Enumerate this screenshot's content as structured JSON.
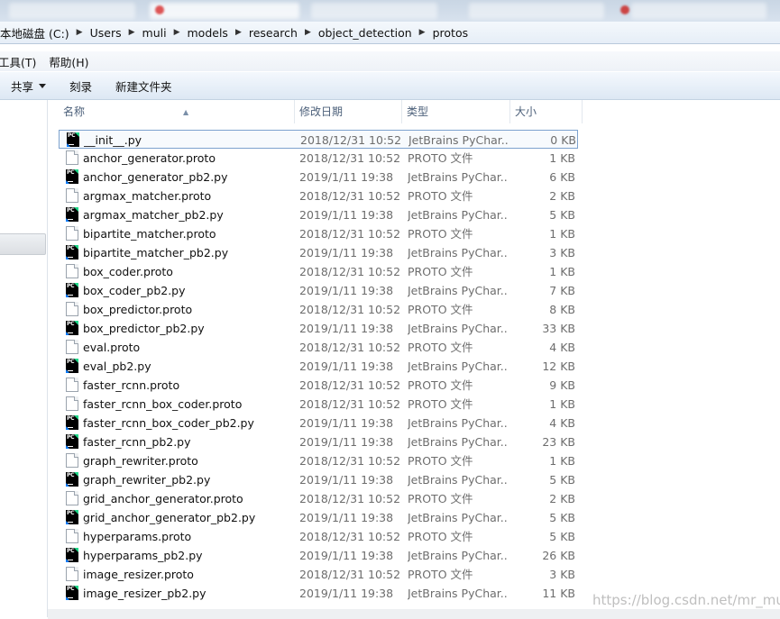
{
  "address": {
    "crumbs": [
      "本地磁盘 (C:)",
      "Users",
      "muli",
      "models",
      "research",
      "object_detection",
      "protos"
    ]
  },
  "menu": [
    "工具(T)",
    "帮助(H)"
  ],
  "toolbar": {
    "share": "共享",
    "burn": "刻录",
    "new_folder": "新建文件夹"
  },
  "columns": {
    "name": "名称",
    "date": "修改日期",
    "type": "类型",
    "size": "大小"
  },
  "files": [
    {
      "name": "__init__.py",
      "date": "2018/12/31 10:52",
      "type": "JetBrains PyChar...",
      "size": "0 KB",
      "kind": "py"
    },
    {
      "name": "anchor_generator.proto",
      "date": "2018/12/31 10:52",
      "type": "PROTO 文件",
      "size": "1 KB",
      "kind": "proto"
    },
    {
      "name": "anchor_generator_pb2.py",
      "date": "2019/1/11 19:38",
      "type": "JetBrains PyChar...",
      "size": "6 KB",
      "kind": "py"
    },
    {
      "name": "argmax_matcher.proto",
      "date": "2018/12/31 10:52",
      "type": "PROTO 文件",
      "size": "2 KB",
      "kind": "proto"
    },
    {
      "name": "argmax_matcher_pb2.py",
      "date": "2019/1/11 19:38",
      "type": "JetBrains PyChar...",
      "size": "5 KB",
      "kind": "py"
    },
    {
      "name": "bipartite_matcher.proto",
      "date": "2018/12/31 10:52",
      "type": "PROTO 文件",
      "size": "1 KB",
      "kind": "proto"
    },
    {
      "name": "bipartite_matcher_pb2.py",
      "date": "2019/1/11 19:38",
      "type": "JetBrains PyChar...",
      "size": "3 KB",
      "kind": "py"
    },
    {
      "name": "box_coder.proto",
      "date": "2018/12/31 10:52",
      "type": "PROTO 文件",
      "size": "1 KB",
      "kind": "proto"
    },
    {
      "name": "box_coder_pb2.py",
      "date": "2019/1/11 19:38",
      "type": "JetBrains PyChar...",
      "size": "7 KB",
      "kind": "py"
    },
    {
      "name": "box_predictor.proto",
      "date": "2018/12/31 10:52",
      "type": "PROTO 文件",
      "size": "8 KB",
      "kind": "proto"
    },
    {
      "name": "box_predictor_pb2.py",
      "date": "2019/1/11 19:38",
      "type": "JetBrains PyChar...",
      "size": "33 KB",
      "kind": "py"
    },
    {
      "name": "eval.proto",
      "date": "2018/12/31 10:52",
      "type": "PROTO 文件",
      "size": "4 KB",
      "kind": "proto"
    },
    {
      "name": "eval_pb2.py",
      "date": "2019/1/11 19:38",
      "type": "JetBrains PyChar...",
      "size": "12 KB",
      "kind": "py"
    },
    {
      "name": "faster_rcnn.proto",
      "date": "2018/12/31 10:52",
      "type": "PROTO 文件",
      "size": "9 KB",
      "kind": "proto"
    },
    {
      "name": "faster_rcnn_box_coder.proto",
      "date": "2018/12/31 10:52",
      "type": "PROTO 文件",
      "size": "1 KB",
      "kind": "proto"
    },
    {
      "name": "faster_rcnn_box_coder_pb2.py",
      "date": "2019/1/11 19:38",
      "type": "JetBrains PyChar...",
      "size": "4 KB",
      "kind": "py"
    },
    {
      "name": "faster_rcnn_pb2.py",
      "date": "2019/1/11 19:38",
      "type": "JetBrains PyChar...",
      "size": "23 KB",
      "kind": "py"
    },
    {
      "name": "graph_rewriter.proto",
      "date": "2018/12/31 10:52",
      "type": "PROTO 文件",
      "size": "1 KB",
      "kind": "proto"
    },
    {
      "name": "graph_rewriter_pb2.py",
      "date": "2019/1/11 19:38",
      "type": "JetBrains PyChar...",
      "size": "5 KB",
      "kind": "py"
    },
    {
      "name": "grid_anchor_generator.proto",
      "date": "2018/12/31 10:52",
      "type": "PROTO 文件",
      "size": "2 KB",
      "kind": "proto"
    },
    {
      "name": "grid_anchor_generator_pb2.py",
      "date": "2019/1/11 19:38",
      "type": "JetBrains PyChar...",
      "size": "5 KB",
      "kind": "py"
    },
    {
      "name": "hyperparams.proto",
      "date": "2018/12/31 10:52",
      "type": "PROTO 文件",
      "size": "5 KB",
      "kind": "proto"
    },
    {
      "name": "hyperparams_pb2.py",
      "date": "2019/1/11 19:38",
      "type": "JetBrains PyChar...",
      "size": "26 KB",
      "kind": "py"
    },
    {
      "name": "image_resizer.proto",
      "date": "2018/12/31 10:52",
      "type": "PROTO 文件",
      "size": "3 KB",
      "kind": "proto"
    },
    {
      "name": "image_resizer_pb2.py",
      "date": "2019/1/11 19:38",
      "type": "JetBrains PyChar...",
      "size": "11 KB",
      "kind": "py"
    }
  ],
  "watermark": "https://blog.csdn.net/mr_muli",
  "colors": {
    "py_icon_bg": "#000000",
    "focus_border": "#7da2ce",
    "header_text": "#4c607a"
  }
}
